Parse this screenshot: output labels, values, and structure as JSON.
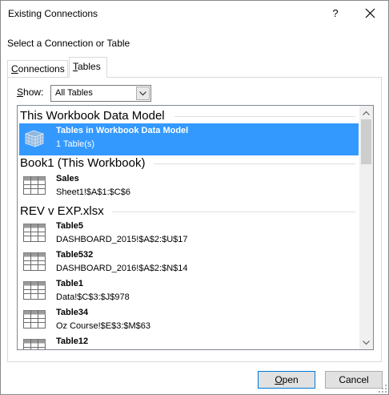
{
  "window": {
    "title": "Existing Connections",
    "help_label": "?"
  },
  "prompt": "Select a Connection or Table",
  "tabs": [
    {
      "label": "Connections",
      "accel": "C",
      "rest": "onnections",
      "selected": false
    },
    {
      "label": "Tables",
      "accel": "T",
      "rest": "ables",
      "selected": true
    }
  ],
  "show": {
    "label_accel": "S",
    "label_rest": "how:",
    "selected": "All Tables"
  },
  "groups": [
    {
      "title": "This Workbook Data Model",
      "items": [
        {
          "name": "Tables in Workbook Data Model",
          "desc": "1 Table(s)",
          "selected": true,
          "icon": "data-model-cube-icon"
        }
      ]
    },
    {
      "title": "Book1 (This Workbook)",
      "items": [
        {
          "name": "Sales",
          "desc": "Sheet1!$A$1:$C$6",
          "selected": false,
          "icon": "table-icon"
        }
      ]
    },
    {
      "title": "REV v EXP.xlsx",
      "items": [
        {
          "name": "Table5",
          "desc": "DASHBOARD_2015!$A$2:$U$17",
          "selected": false,
          "icon": "table-icon"
        },
        {
          "name": "Table532",
          "desc": "DASHBOARD_2016!$A$2:$N$14",
          "selected": false,
          "icon": "table-icon"
        },
        {
          "name": "Table1",
          "desc": "Data!$C$3:$J$978",
          "selected": false,
          "icon": "table-icon"
        },
        {
          "name": "Table34",
          "desc": "Oz Course!$E$3:$M$63",
          "selected": false,
          "icon": "table-icon"
        },
        {
          "name": "Table12",
          "desc": "",
          "selected": false,
          "icon": "table-icon"
        }
      ]
    }
  ],
  "buttons": {
    "open_accel": "O",
    "open_rest": "pen",
    "cancel": "Cancel"
  },
  "colors": {
    "selection": "#3399ff",
    "accent_border": "#0078d7"
  }
}
